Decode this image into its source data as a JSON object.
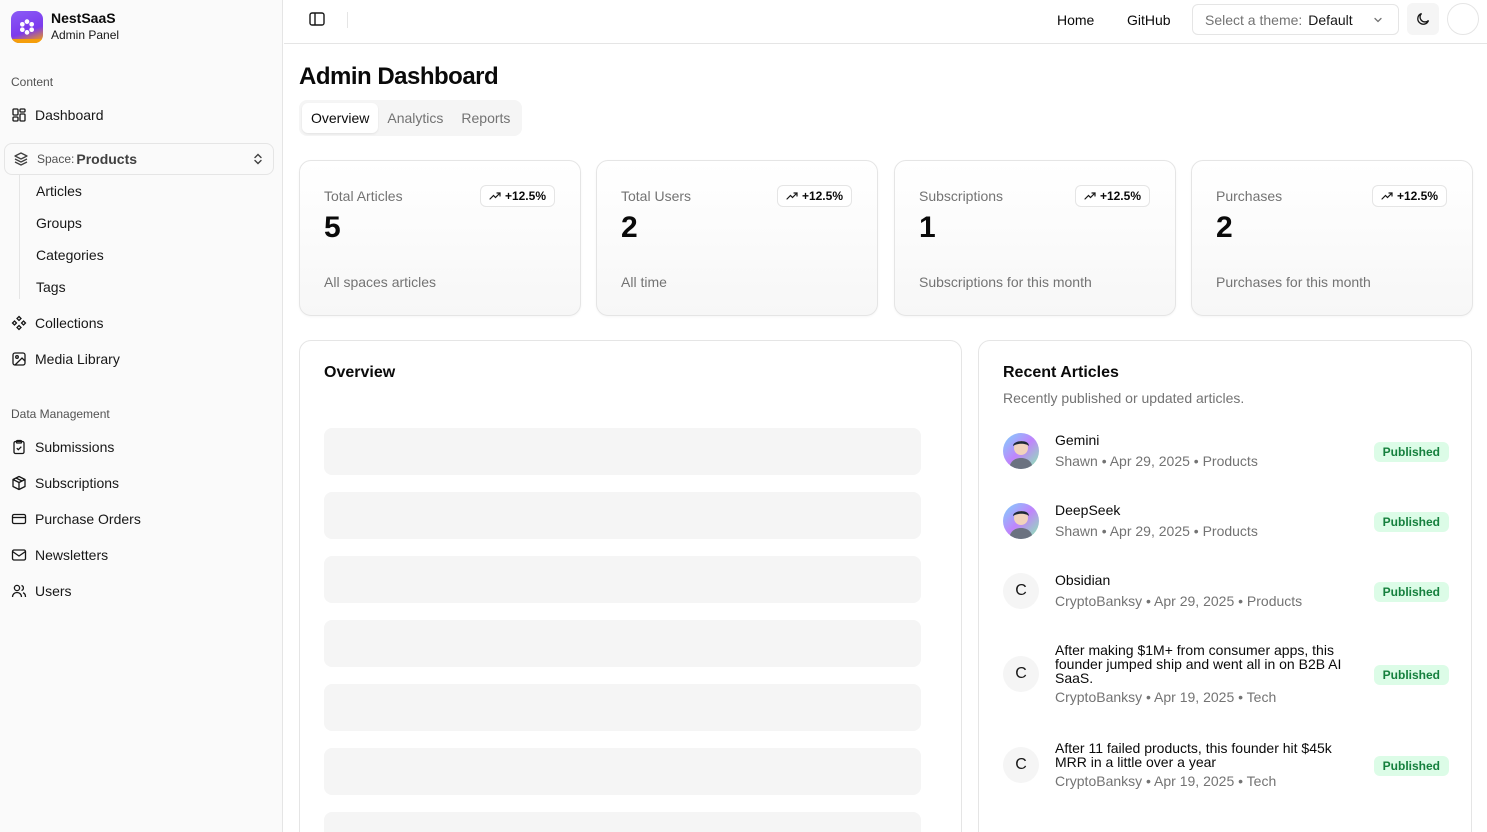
{
  "brand": {
    "name": "NestSaaS",
    "subtitle": "Admin Panel"
  },
  "sidebar": {
    "content_label": "Content",
    "dashboard": "Dashboard",
    "space": {
      "prefix": "Space:",
      "value": "Products"
    },
    "space_items": [
      "Articles",
      "Groups",
      "Categories",
      "Tags"
    ],
    "collections": "Collections",
    "media_library": "Media Library",
    "data_label": "Data Management",
    "data_items": [
      "Submissions",
      "Subscriptions",
      "Purchase Orders",
      "Newsletters",
      "Users"
    ]
  },
  "header": {
    "home": "Home",
    "github": "GitHub",
    "theme_label": "Select a theme:",
    "theme_value": "Default"
  },
  "page": {
    "title": "Admin Dashboard",
    "tabs": [
      "Overview",
      "Analytics",
      "Reports"
    ],
    "active_tab": "Overview"
  },
  "stats": [
    {
      "title": "Total Articles",
      "badge": "+12.5%",
      "value": "5",
      "footer": "All spaces articles"
    },
    {
      "title": "Total Users",
      "badge": "+12.5%",
      "value": "2",
      "footer": "All time"
    },
    {
      "title": "Subscriptions",
      "badge": "+12.5%",
      "value": "1",
      "footer": "Subscriptions for this month"
    },
    {
      "title": "Purchases",
      "badge": "+12.5%",
      "value": "2",
      "footer": "Purchases for this month"
    }
  ],
  "overview": {
    "title": "Overview"
  },
  "recent": {
    "title": "Recent Articles",
    "description": "Recently published or updated articles.",
    "items": [
      {
        "title": "Gemini",
        "meta": "Shawn • Apr 29, 2025 • Products",
        "status": "Published",
        "avatar": ""
      },
      {
        "title": "DeepSeek",
        "meta": "Shawn • Apr 29, 2025 • Products",
        "status": "Published",
        "avatar": ""
      },
      {
        "title": "Obsidian",
        "meta": "CryptoBanksy • Apr 29, 2025 • Products",
        "status": "Published",
        "avatar": "C"
      },
      {
        "title": "After making $1M+ from consumer apps, this founder jumped ship and went all in on B2B AI SaaS.",
        "meta": "CryptoBanksy • Apr 19, 2025 • Tech",
        "status": "Published",
        "avatar": "C"
      },
      {
        "title": "After 11 failed products, this founder hit $45k MRR in a little over a year",
        "meta": "CryptoBanksy • Apr 19, 2025 • Tech",
        "status": "Published",
        "avatar": "C"
      }
    ]
  }
}
